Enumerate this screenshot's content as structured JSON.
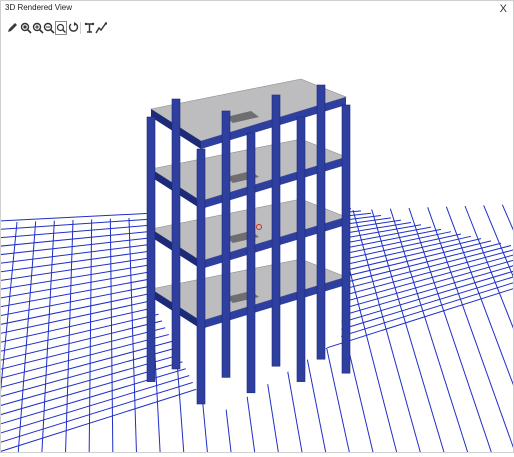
{
  "window": {
    "title": "3D Rendered View",
    "close_glyph": "X"
  },
  "toolbar": {
    "icons": [
      "pencil-icon",
      "zoom-window-icon",
      "zoom-in-icon",
      "zoom-out-icon",
      "zoom-extents-icon",
      "rotate-icon",
      "pan-icon",
      "settings-icon"
    ]
  },
  "colors": {
    "frame": "#2f3f9f",
    "frame_dark": "#1c2a78",
    "slab": "#a9a9ab",
    "slab_light": "#bdbdbf",
    "grid": "#1f2fc7",
    "origin_marker": "#d22a2a"
  }
}
